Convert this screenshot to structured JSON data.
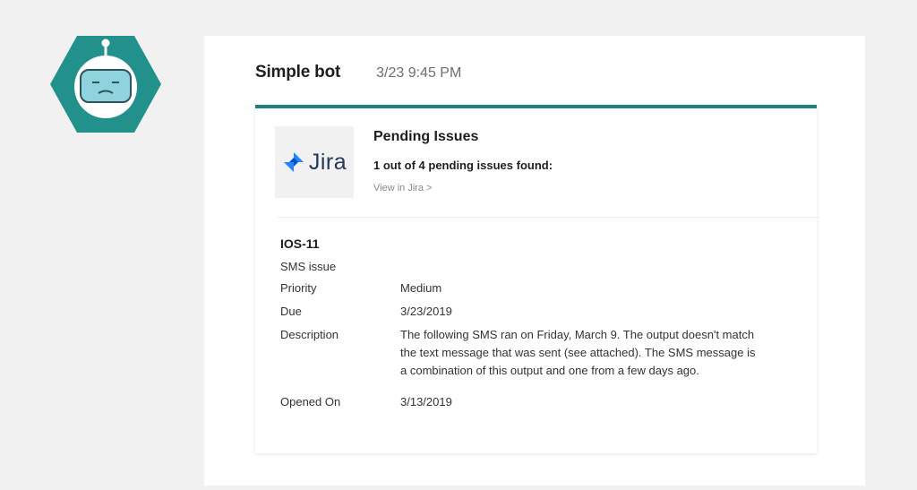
{
  "message": {
    "bot_name": "Simple bot",
    "timestamp": "3/23 9:45 PM"
  },
  "avatar": {
    "icon": "sad-robot-icon",
    "colors": {
      "hexagon": "#22918c",
      "face": "#8fd3dc",
      "screen": "#ffffff"
    }
  },
  "card": {
    "accent_color": "#1e7f7d",
    "logo": {
      "icon": "jira-logo-icon",
      "text": "Jira"
    },
    "title": "Pending Issues",
    "subtitle": "1 out of 4 pending issues found:",
    "link_text": "View in Jira >"
  },
  "issue": {
    "key": "IOS-11",
    "summary": "SMS issue",
    "fields": {
      "priority": {
        "label": "Priority",
        "value": "Medium"
      },
      "due": {
        "label": "Due",
        "value": "3/23/2019"
      },
      "description": {
        "label": "Description",
        "value": "The following SMS ran on Friday, March 9. The output doesn't match the text message that was sent (see attached). The SMS message is a combination of this output and one from a few days ago."
      },
      "opened_on": {
        "label": "Opened On",
        "value": "3/13/2019"
      }
    }
  }
}
